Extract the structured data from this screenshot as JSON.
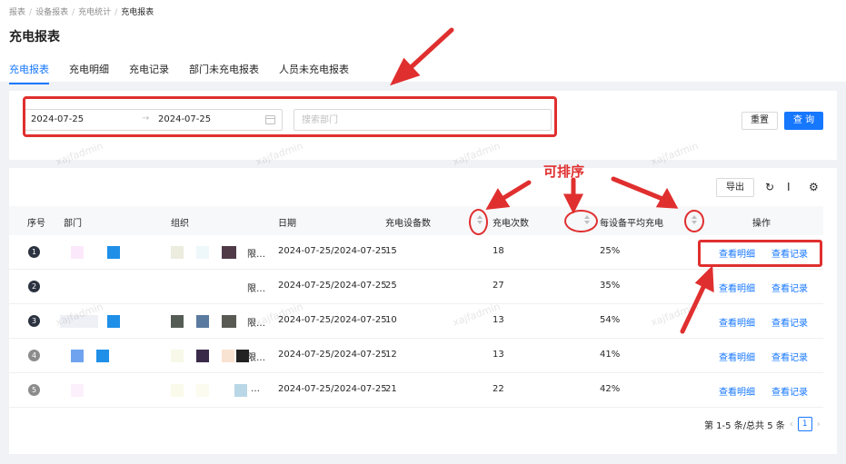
{
  "breadcrumb": [
    "报表",
    "设备报表",
    "充电统计",
    "充电报表"
  ],
  "page_title": "充电报表",
  "tabs": [
    {
      "label": "充电报表",
      "active": true
    },
    {
      "label": "充电明细",
      "active": false
    },
    {
      "label": "充电记录",
      "active": false
    },
    {
      "label": "部门未充电报表",
      "active": false
    },
    {
      "label": "人员未充电报表",
      "active": false
    }
  ],
  "filter": {
    "date_start": "2024-07-25",
    "date_end": "2024-07-25",
    "date_separator": "→",
    "dept_placeholder": "搜索部门",
    "reset_label": "重置",
    "query_label": "查 询"
  },
  "toolbar": {
    "export_label": "导出",
    "refresh_icon": "refresh-icon",
    "density_icon": "column-height-icon",
    "settings_icon": "setting-icon"
  },
  "table": {
    "headers": {
      "index": "序号",
      "dept": "部门",
      "org": "组织",
      "date": "日期",
      "devices": "充电设备数",
      "times": "充电次数",
      "avg": "每设备平均充电",
      "ops": "操作"
    },
    "rows": [
      {
        "index": "1",
        "org_suffix": "限…",
        "date": "2024-07-25/2024-07-25",
        "devices": "15",
        "times": "18",
        "avg": "25%"
      },
      {
        "index": "2",
        "org_suffix": "限…",
        "date": "2024-07-25/2024-07-25",
        "devices": "25",
        "times": "27",
        "avg": "35%"
      },
      {
        "index": "3",
        "org_suffix": "限…",
        "date": "2024-07-25/2024-07-25",
        "devices": "10",
        "times": "13",
        "avg": "54%"
      },
      {
        "index": "4",
        "org_suffix": "限…",
        "date": "2024-07-25/2024-07-25",
        "devices": "12",
        "times": "13",
        "avg": "41%"
      },
      {
        "index": "5",
        "org_suffix": "…",
        "date": "2024-07-25/2024-07-25",
        "devices": "21",
        "times": "22",
        "avg": "42%"
      }
    ],
    "link_detail": "查看明细",
    "link_record": "查看记录"
  },
  "pagination": {
    "summary": "第 1-5 条/总共 5 条",
    "current_page": "1"
  },
  "annotation": {
    "sortable_label": "可排序",
    "color": "#e02f2f"
  },
  "watermark": "xajfadmin",
  "colors": {
    "primary": "#1677ff",
    "annotation": "#e02f2f"
  }
}
